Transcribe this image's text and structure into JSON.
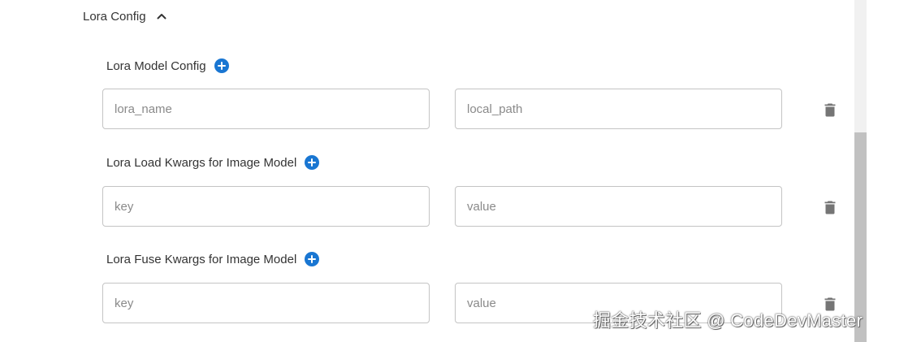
{
  "section": {
    "title": "Lora Config",
    "expanded": true
  },
  "groups": [
    {
      "title": "Lora Model Config",
      "fields": [
        {
          "placeholder": "lora_name",
          "value": ""
        },
        {
          "placeholder": "local_path",
          "value": ""
        }
      ]
    },
    {
      "title": "Lora Load Kwargs for Image Model",
      "fields": [
        {
          "placeholder": "key",
          "value": ""
        },
        {
          "placeholder": "value",
          "value": ""
        }
      ]
    },
    {
      "title": "Lora Fuse Kwargs for Image Model",
      "fields": [
        {
          "placeholder": "key",
          "value": ""
        },
        {
          "placeholder": "value",
          "value": ""
        }
      ]
    }
  ],
  "icons": {
    "collapse": "chevron-up-icon",
    "add": "add-circle-icon",
    "delete": "trash-icon"
  },
  "colors": {
    "accent": "#1976d2",
    "delete_icon": "#757575",
    "border": "#c4c4c4"
  },
  "watermark": "掘金技术社区 @ CodeDevMaster"
}
